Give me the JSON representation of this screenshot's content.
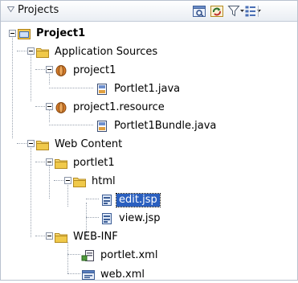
{
  "panel": {
    "title": "Projects"
  },
  "toolbar": {
    "icons": [
      "project-view-icon",
      "sync-icon",
      "filter-icon",
      "working-sets-icon"
    ]
  },
  "tree": {
    "items": [
      {
        "label": "Project1",
        "icon": "project-icon",
        "expanded": true
      },
      {
        "label": "Application Sources",
        "icon": "folder-icon",
        "expanded": true
      },
      {
        "label": "project1",
        "icon": "package-icon",
        "expanded": true
      },
      {
        "label": "Portlet1.java",
        "icon": "java-file-icon"
      },
      {
        "label": "project1.resource",
        "icon": "package-icon",
        "expanded": true
      },
      {
        "label": "Portlet1Bundle.java",
        "icon": "java-file-icon"
      },
      {
        "label": "Web Content",
        "icon": "folder-icon",
        "expanded": true
      },
      {
        "label": "portlet1",
        "icon": "folder-icon",
        "expanded": true
      },
      {
        "label": "html",
        "icon": "folder-icon",
        "expanded": true
      },
      {
        "label": "edit.jsp",
        "icon": "jsp-file-icon",
        "selected": true
      },
      {
        "label": "view.jsp",
        "icon": "jsp-file-icon"
      },
      {
        "label": "WEB-INF",
        "icon": "folder-icon",
        "expanded": true
      },
      {
        "label": "portlet.xml",
        "icon": "portlet-xml-icon"
      },
      {
        "label": "web.xml",
        "icon": "xml-file-icon"
      }
    ]
  },
  "colors": {
    "selection": "#2a5fbf",
    "folder": "#f0c94a",
    "package": "#d27a2a",
    "header_bg": "#e9edf3"
  }
}
